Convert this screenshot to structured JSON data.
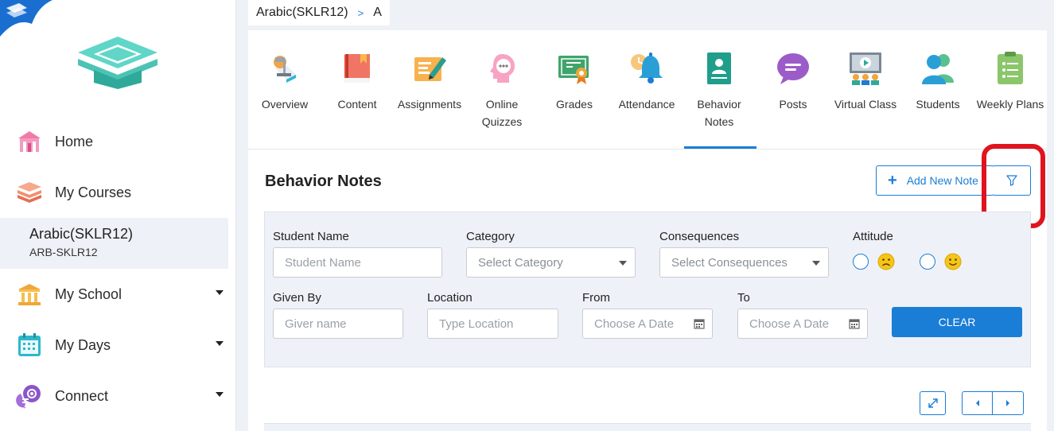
{
  "sidebar": {
    "items": [
      {
        "label": "Home",
        "icon": "home-icon"
      },
      {
        "label": "My Courses",
        "icon": "courses-icon"
      },
      {
        "label": "My School",
        "icon": "school-icon"
      },
      {
        "label": "My Days",
        "icon": "calendar-icon"
      },
      {
        "label": "Connect",
        "icon": "connect-icon"
      }
    ],
    "active_course": {
      "name": "Arabic(SKLR12)",
      "code": "ARB-SKLR12"
    }
  },
  "breadcrumb": {
    "course": "Arabic(SKLR12)",
    "separator": ">",
    "section": "A"
  },
  "tabs": [
    {
      "label": "Overview",
      "icon": "overview-icon"
    },
    {
      "label": "Content",
      "icon": "book-icon"
    },
    {
      "label": "Assignments",
      "icon": "assignments-icon"
    },
    {
      "label": "Online",
      "label2": "Quizzes",
      "icon": "quiz-icon"
    },
    {
      "label": "Grades",
      "icon": "grades-icon"
    },
    {
      "label": "Attendance",
      "icon": "bell-icon"
    },
    {
      "label": "Behavior",
      "label2": "Notes",
      "icon": "behavior-notes-icon"
    },
    {
      "label": "Posts",
      "icon": "posts-icon"
    },
    {
      "label": "Virtual Class",
      "icon": "virtual-class-icon"
    },
    {
      "label": "Students",
      "icon": "students-icon"
    },
    {
      "label": "Weekly Plans",
      "icon": "weekly-plans-icon"
    }
  ],
  "active_tab": "Behavior Notes",
  "section": {
    "title": "Behavior Notes",
    "add_label": "Add New Note"
  },
  "filters": {
    "student_name": {
      "label": "Student Name",
      "placeholder": "Student Name"
    },
    "category": {
      "label": "Category",
      "value": "Select Category"
    },
    "consequences": {
      "label": "Consequences",
      "value": "Select Consequences"
    },
    "attitude": {
      "label": "Attitude"
    },
    "given_by": {
      "label": "Given By",
      "placeholder": "Giver name"
    },
    "location": {
      "label": "Location",
      "placeholder": "Type Location"
    },
    "from": {
      "label": "From",
      "placeholder": "Choose A Date"
    },
    "to": {
      "label": "To",
      "placeholder": "Choose A Date"
    },
    "clear_label": "CLEAR"
  },
  "colors": {
    "accent": "#1a7dd6",
    "highlight": "#e0141e",
    "panel": "#eef1f7"
  }
}
